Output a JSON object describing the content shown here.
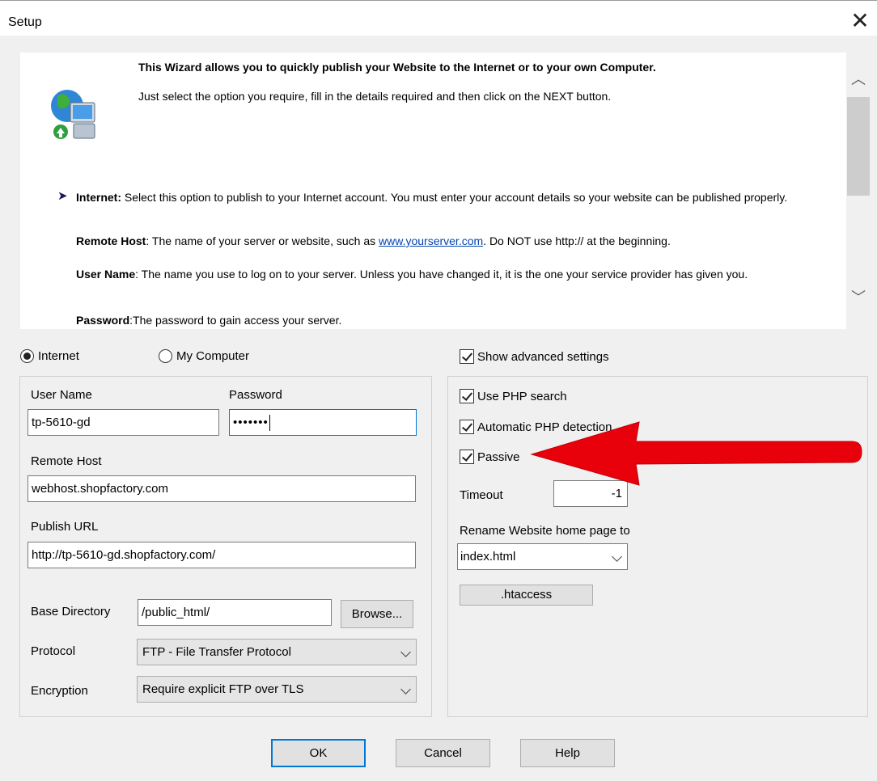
{
  "window": {
    "title": "Setup",
    "close": "✕"
  },
  "help": {
    "intro_bold": "This Wizard allows you to quickly publish your Website to the Internet or to your own Computer.",
    "intro_text": "Just select the option you require, fill in the details required and then click on the NEXT button.",
    "bullet": "➤",
    "internet_term": "Internet:",
    "internet_desc": " Select this option to publish to your Internet account. You must enter your account details so your website can be published properly.",
    "remote_term": "Remote Host",
    "remote_desc": ": The name of your server or website, such as ",
    "remote_link": "www.yourserver.com",
    "remote_desc2": ". Do NOT use http:// at the beginning.",
    "user_term": "User Name",
    "user_desc": ": The name you use to log on to your server. Unless you have changed it, it is the one your service provider has given you.",
    "pass_term": "Password",
    "pass_desc": ":The password to gain access your server."
  },
  "destination": {
    "internet": "Internet",
    "my_computer": "My Computer",
    "selected": "internet"
  },
  "form": {
    "user_name_label": "User Name",
    "user_name_value": "tp-5610-gd",
    "password_label": "Password",
    "password_value": "•••••••",
    "remote_host_label": "Remote Host",
    "remote_host_value": "webhost.shopfactory.com",
    "publish_url_label": "Publish URL",
    "publish_url_value": "http://tp-5610-gd.shopfactory.com/",
    "base_dir_label": "Base Directory",
    "base_dir_value": "/public_html/",
    "browse_label": "Browse...",
    "protocol_label": "Protocol",
    "protocol_value": "FTP - File Transfer Protocol",
    "encryption_label": "Encryption",
    "encryption_value": "Require explicit FTP over TLS"
  },
  "advanced": {
    "show_label": "Show advanced settings",
    "php_search_label": "Use PHP search",
    "php_detect_label": "Automatic PHP detection",
    "passive_label": "Passive",
    "timeout_label": "Timeout",
    "timeout_value": "-1",
    "rename_label": "Rename Website home page to",
    "rename_value": "index.html",
    "htaccess_label": ".htaccess"
  },
  "buttons": {
    "ok": "OK",
    "cancel": "Cancel",
    "help": "Help"
  },
  "colors": {
    "arrow": "#e8000b",
    "accent": "#0078d7",
    "link": "#0645ad"
  }
}
